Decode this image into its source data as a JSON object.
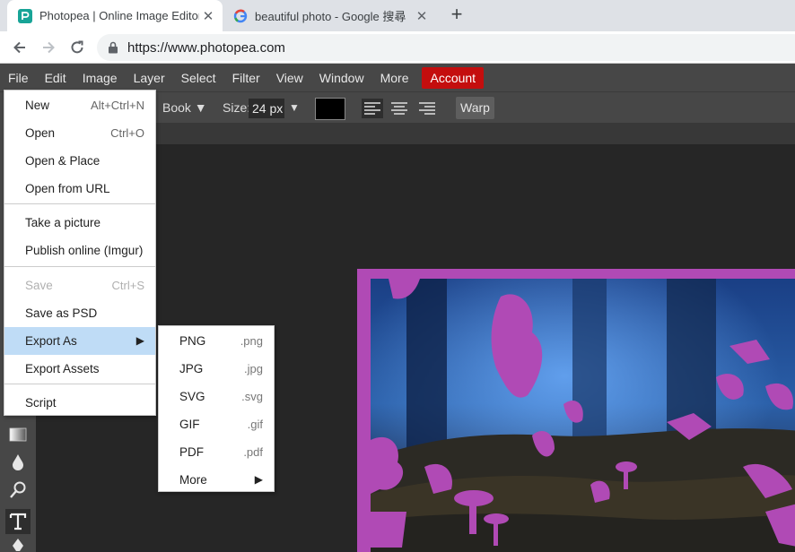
{
  "browser": {
    "tabs": [
      {
        "title": "Photopea | Online Image Editor",
        "active": true,
        "close": "✕"
      },
      {
        "title": "beautiful photo - Google 搜尋",
        "active": false,
        "close": "✕"
      }
    ],
    "new_tab_symbol": "+",
    "url": "https://www.photopea.com"
  },
  "menubar": {
    "items": [
      "File",
      "Edit",
      "Image",
      "Layer",
      "Select",
      "Filter",
      "View",
      "Window",
      "More"
    ],
    "account": "Account",
    "account_color": "#c40e0e"
  },
  "options": {
    "font_style": "Book ▼",
    "size_label": "Size:",
    "size_value": "24 px",
    "size_arrow": "▼",
    "text_color": "#000000",
    "warp_label": "Warp"
  },
  "file_menu": {
    "items": [
      {
        "label": "New",
        "shortcut": "Alt+Ctrl+N"
      },
      {
        "label": "Open",
        "shortcut": "Ctrl+O"
      },
      {
        "label": "Open & Place",
        "shortcut": ""
      },
      {
        "label": "Open from URL",
        "shortcut": ""
      },
      {
        "label": "Take a picture",
        "shortcut": ""
      },
      {
        "label": "Publish online (Imgur)",
        "shortcut": ""
      },
      {
        "label": "Save",
        "shortcut": "Ctrl+S",
        "disabled": true
      },
      {
        "label": "Save as PSD",
        "shortcut": ""
      },
      {
        "label": "Export As",
        "shortcut": "",
        "submenu_arrow": "▶",
        "highlighted": true
      },
      {
        "label": "Export Assets",
        "shortcut": ""
      },
      {
        "label": "Script",
        "shortcut": ""
      }
    ]
  },
  "export_submenu": {
    "items": [
      {
        "label": "PNG",
        "ext": ".png"
      },
      {
        "label": "JPG",
        "ext": ".jpg"
      },
      {
        "label": "SVG",
        "ext": ".svg"
      },
      {
        "label": "GIF",
        "ext": ".gif"
      },
      {
        "label": "PDF",
        "ext": ".pdf"
      },
      {
        "label": "More",
        "ext": "",
        "arrow": "▶"
      }
    ]
  },
  "icons": {
    "tab1_favicon": "photopea-icon",
    "tab2_favicon": "google-icon",
    "tools": [
      "gradient-icon",
      "blur-icon",
      "dodge-icon",
      "text-tool-icon",
      "pen-icon"
    ]
  },
  "colors": {
    "canvas_border": "#b04ab5",
    "menu_highlight": "#bfdcf6"
  }
}
